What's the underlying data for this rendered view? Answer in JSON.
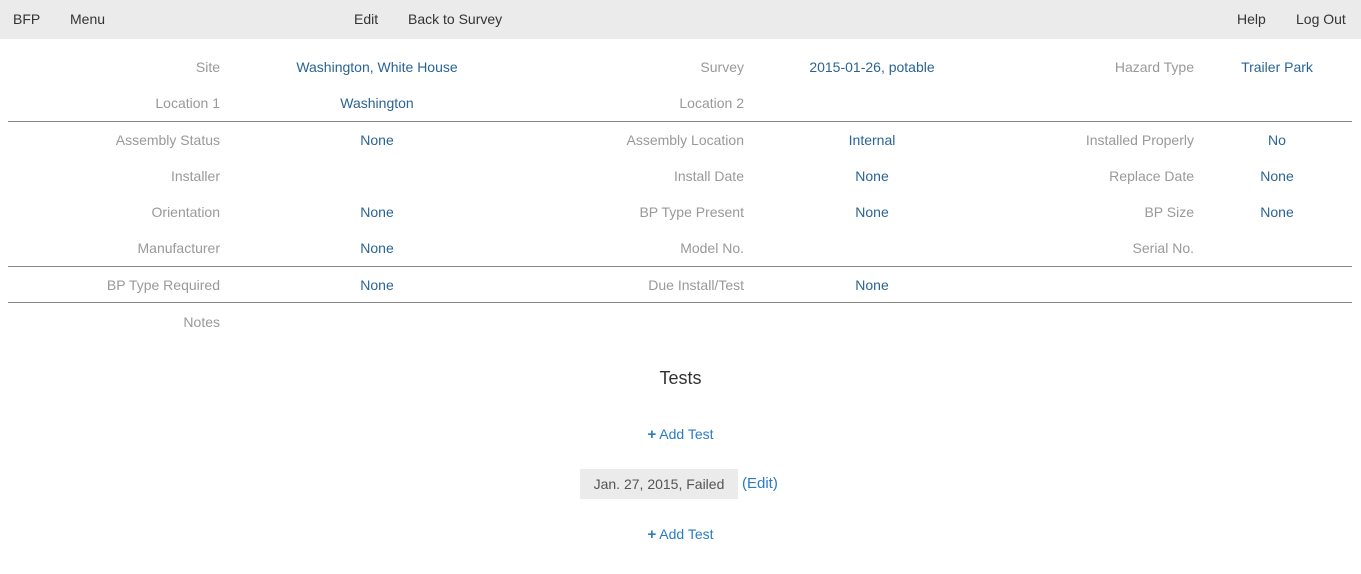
{
  "nav": {
    "brand": "BFP",
    "menu": "Menu",
    "edit": "Edit",
    "back": "Back to Survey",
    "help": "Help",
    "logout": "Log Out"
  },
  "details": {
    "site_label": "Site",
    "site_value": "Washington, White House",
    "survey_label": "Survey",
    "survey_value": "2015-01-26, potable",
    "hazard_label": "Hazard Type",
    "hazard_value": "Trailer Park",
    "location1_label": "Location 1",
    "location1_value": "Washington",
    "location2_label": "Location 2",
    "assembly_status_label": "Assembly Status",
    "assembly_status_value": "None",
    "assembly_location_label": "Assembly Location",
    "assembly_location_value": "Internal",
    "installed_properly_label": "Installed Properly",
    "installed_properly_value": "No",
    "installer_label": "Installer",
    "install_date_label": "Install Date",
    "install_date_value": "None",
    "replace_date_label": "Replace Date",
    "replace_date_value": "None",
    "orientation_label": "Orientation",
    "orientation_value": "None",
    "bp_type_present_label": "BP Type Present",
    "bp_type_present_value": "None",
    "bp_size_label": "BP Size",
    "bp_size_value": "None",
    "manufacturer_label": "Manufacturer",
    "manufacturer_value": "None",
    "model_label": "Model No.",
    "serial_label": "Serial No.",
    "bp_type_required_label": "BP Type Required",
    "bp_type_required_value": "None",
    "due_label": "Due Install/Test",
    "due_value": "None",
    "notes_label": "Notes"
  },
  "tests": {
    "title": "Tests",
    "add_label": "Add Test",
    "add_icon": "+",
    "items": [
      {
        "summary": "Jan. 27, 2015, Failed",
        "edit_label": "(Edit)"
      }
    ]
  }
}
